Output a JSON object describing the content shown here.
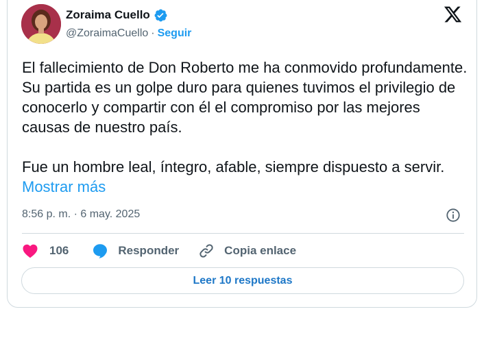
{
  "author": {
    "display_name": "Zoraima Cuello",
    "handle": "@ZoraimaCuello",
    "separator": "·",
    "follow_label": "Seguir"
  },
  "tweet": {
    "paragraph1": "El fallecimiento de Don Roberto me ha conmovido profundamente. Su partida es un golpe duro para quienes tuvimos el privilegio de conocerlo y compartir con él el compromiso por las mejores causas de nuestro país.",
    "paragraph2": "Fue un hombre leal, íntegro, afable, siempre dispuesto a servir.",
    "show_more_label": "Mostrar más",
    "timestamp": "8:56 p. m. · 6 may. 2025"
  },
  "actions": {
    "like_count": "106",
    "reply_label": "Responder",
    "copy_link_label": "Copia enlace"
  },
  "replies_button_label": "Leer 10 respuestas",
  "icons": {
    "verified": "verified-badge-icon",
    "x_logo": "x-logo-icon",
    "info": "info-icon",
    "heart": "heart-icon",
    "reply": "speech-bubble-icon",
    "link": "link-icon"
  },
  "colors": {
    "accent": "#1d9bf0",
    "heart": "#f91880",
    "text": "#0f1419",
    "muted": "#536471",
    "border": "#cfd9de"
  }
}
